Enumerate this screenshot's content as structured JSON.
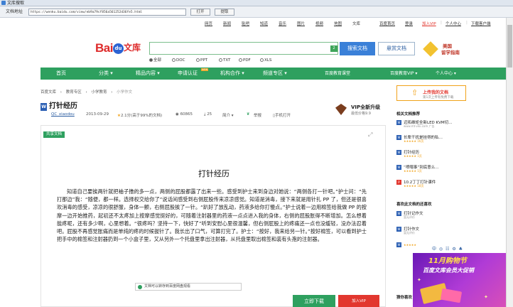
{
  "window": {
    "title": "文库搜取"
  },
  "urlbar": {
    "label": "文档地址",
    "address": "https://wenku.baidu.com/view/eb9a79cf856a561252d36fe5.html",
    "open_button": "打开",
    "extract_button": "提取"
  },
  "topnav": {
    "items": [
      "网页",
      "新闻",
      "贴吧",
      "知道",
      "音乐",
      "图片",
      "视频",
      "地图",
      "文库"
    ],
    "right": [
      "百度首页",
      "登录",
      "加入VIP",
      "|",
      "个人中心",
      "|",
      "下载客户端"
    ]
  },
  "header": {
    "logo_bai": "Bai",
    "logo_du": "du",
    "logo_wenku": "文库",
    "search_placeholder": "",
    "search_badge": "2",
    "search_button": "搜索文档",
    "tag_button": "悬赏文档",
    "filters": [
      "全部",
      "DOC",
      "PPT",
      "TXT",
      "PDF",
      "XLS"
    ],
    "selected_filter": "全部",
    "ad": {
      "line1": "美国",
      "line2": "留学指南"
    }
  },
  "menubar": {
    "items": [
      "首页",
      "分类 ▾",
      "精品内容 ▾",
      "申请认证",
      "机构合作 ▾",
      "频道专区 ▾",
      "百度教育课堂",
      "百度教育VIP ▾",
      "个人中心 ▾"
    ],
    "hot_label": "NEW"
  },
  "breadcrumb": [
    "百度文库",
    "›",
    "教育专区",
    "›",
    "小学教育",
    "›",
    "小学作文"
  ],
  "document": {
    "type_icon_label": "W",
    "title": "打针经历",
    "author": "QC_xiaodou",
    "date": "2013-09-29",
    "rating": "2.1分(高于99%的文档)",
    "views": "60865",
    "downloads": "25",
    "intro": "简介",
    "report": "举报",
    "mobile": "手机打开",
    "share_tag": "共享文档",
    "heading": "打针经历",
    "body": "知道自己要挨两针就把袖子撸的多一点，两侧的屁股都露了出来一些。感受到护士来到身边对她说：“两侧各打一针吧。”护士问：“先打那边”我：“随便，都一样。选择权交给你了”说话间感受到右侧屁股传来凉凉感觉。知道是消毒，接下来就是用针扎 PP 了，但还是很喜欢消毒的感受，凉凉的很舒服，身体一颤，右侧屁股挨了一针。“趴好了放乱动，药液多给你打慢点。”护士说着一边用棉签给我做 PP 的按摩一边开始推药，起初还不太疼加上按摩感觉挺好的，可随着注射器里的药液一点点进入我的身体，右侧的屁股胀得不断增加。怎么想着能疼呢，还有多少啊，心里想着。“很疼吗？坚持一下，快好了”听到安慰心里很温馨，但右侧屁股上的疼痛还一点也没缓轻，没办法忍着吧。屁股不再感觉胀痛而是单纯的疼的时候拔针了。我长出了口气，可算打完了。护士：“按好，我来给另一针。”按好棉签，可以看到护士把手中的棉签和注射器扔到一个小盒子里，又从另外一个托盘里拿出注射器，从托盘里取出棉签和装有头孢的注射器。",
    "tip": "文档可以转存到百度网盘观看",
    "download_button": "立即下载",
    "vip_button": "加入VIP"
  },
  "vip_promo": {
    "title": "VIP全新升级",
    "sub": "最低价格9.9"
  },
  "sidebar": {
    "upload_title": "上传我的文档",
    "upload_sub": "第1次上传有免费下载",
    "related_title": "相关文档推荐",
    "related": [
      {
        "icon": "W",
        "name": "迈拓维矩全新LED KVM切…",
        "sub": "www.mt-viki.com  广告",
        "stars": ""
      },
      {
        "icon": "W",
        "name": "长辈干扰是挂得的私…",
        "sub": "",
        "stars": "★★★★★ 16页"
      },
      {
        "icon": "W",
        "name": "打针经历",
        "sub": "",
        "stars": "★★★★★ 1页"
      },
      {
        "icon": "W",
        "name": "“喷嚏事”到底意么…",
        "sub": "",
        "stars": "★★★★★ 1页"
      },
      {
        "icon": "P",
        "name": "10.2丁丁打针课件",
        "sub": "",
        "stars": "★★★★★ 18页"
      }
    ],
    "similar_title": "喜欢此文档的还喜欢",
    "similar": [
      {
        "icon": "W",
        "name": "打针记作文",
        "sub": "暂无评价",
        "stars": ""
      },
      {
        "icon": "W",
        "name": "打针作文",
        "sub": "暂无评价",
        "stars": ""
      },
      {
        "icon": "W",
        "name": "",
        "sub": "",
        "stars": "★★★★★"
      }
    ],
    "tools": "中 ◎ ☷ ⚙ ♣",
    "more_label": "猜你喜欢"
  },
  "promo": {
    "line1": "11月购物节",
    "line2": "百度文库会员大促销"
  },
  "colors": {
    "accent_green": "#2ea05f",
    "brand_red": "#de2b2b",
    "search_blue": "#3a80d8",
    "promo_purple": "#6a18b6"
  }
}
